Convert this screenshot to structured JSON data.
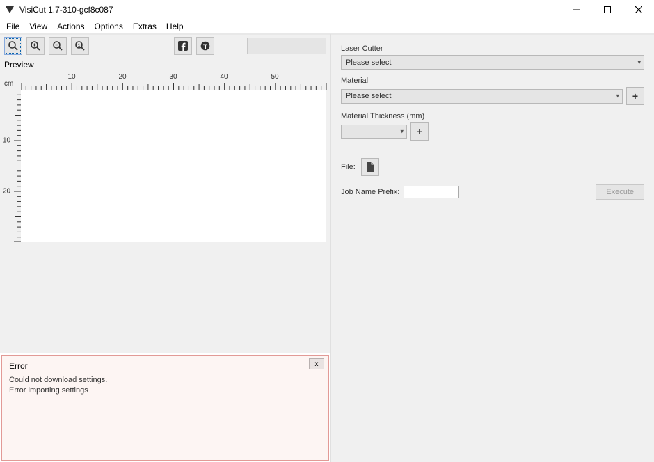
{
  "title": "VisiCut 1.7-310-gcf8c087",
  "menus": [
    "File",
    "View",
    "Actions",
    "Options",
    "Extras",
    "Help"
  ],
  "preview_label": "Preview",
  "ruler_unit": "cm",
  "ruler_x": [
    "10",
    "20",
    "30",
    "40",
    "50"
  ],
  "ruler_y": [
    "10",
    "20"
  ],
  "error": {
    "title": "Error",
    "message": "Could not download settings.\nError importing settings",
    "close": "x"
  },
  "right": {
    "laser_label": "Laser Cutter",
    "laser_value": "Please select",
    "material_label": "Material",
    "material_value": "Please select",
    "thickness_label": "Material Thickness (mm)",
    "thickness_value": "",
    "add": "+",
    "file_label": "File:",
    "job_label": "Job Name Prefix:",
    "job_value": "",
    "execute": "Execute"
  }
}
